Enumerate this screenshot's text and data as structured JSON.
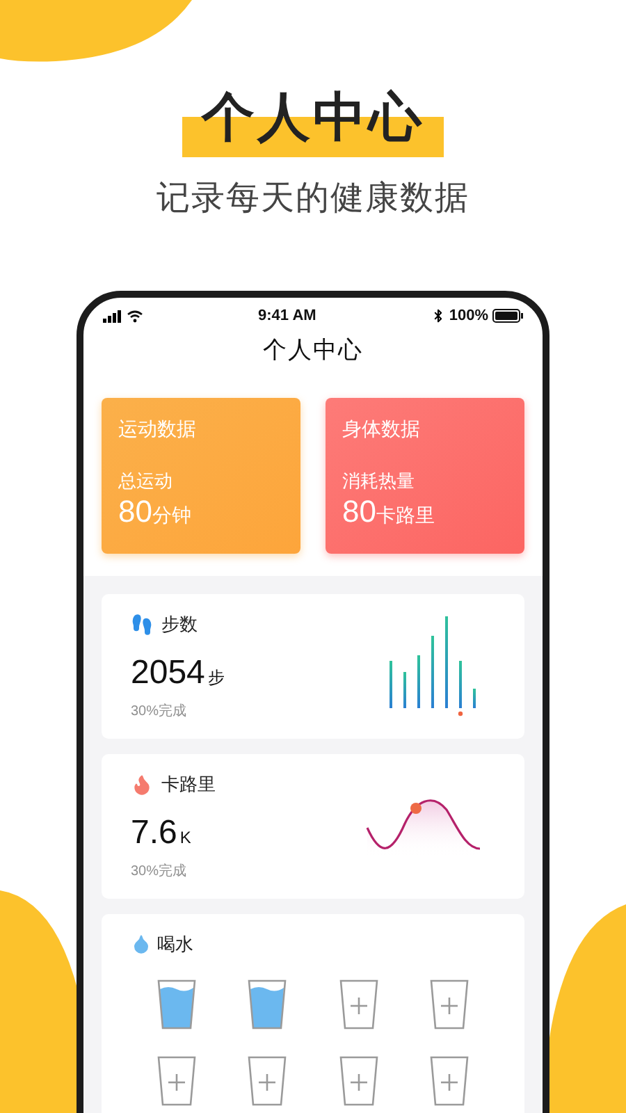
{
  "banner": {
    "title": "个人中心",
    "subtitle": "记录每天的健康数据"
  },
  "status_bar": {
    "time": "9:41 AM",
    "battery": "100%"
  },
  "screen_title": "个人中心",
  "summary_cards": [
    {
      "kind": "sport",
      "title": "运动数据",
      "label": "总运动",
      "value": "80",
      "unit": "分钟"
    },
    {
      "kind": "body",
      "title": "身体数据",
      "label": "消耗热量",
      "value": "80",
      "unit": "卡路里"
    }
  ],
  "metrics": [
    {
      "kind": "steps",
      "title": "步数",
      "value": "2054",
      "unit": "步",
      "note": "30%完成"
    },
    {
      "kind": "calories",
      "title": "卡路里",
      "value": "7.6",
      "unit": "K",
      "note": "30%完成"
    }
  ],
  "water": {
    "title": "喝水",
    "cups": [
      {
        "filled": true
      },
      {
        "filled": true
      },
      {
        "filled": false
      },
      {
        "filled": false
      },
      {
        "filled": false
      },
      {
        "filled": false
      },
      {
        "filled": false
      },
      {
        "filled": false
      }
    ]
  }
}
